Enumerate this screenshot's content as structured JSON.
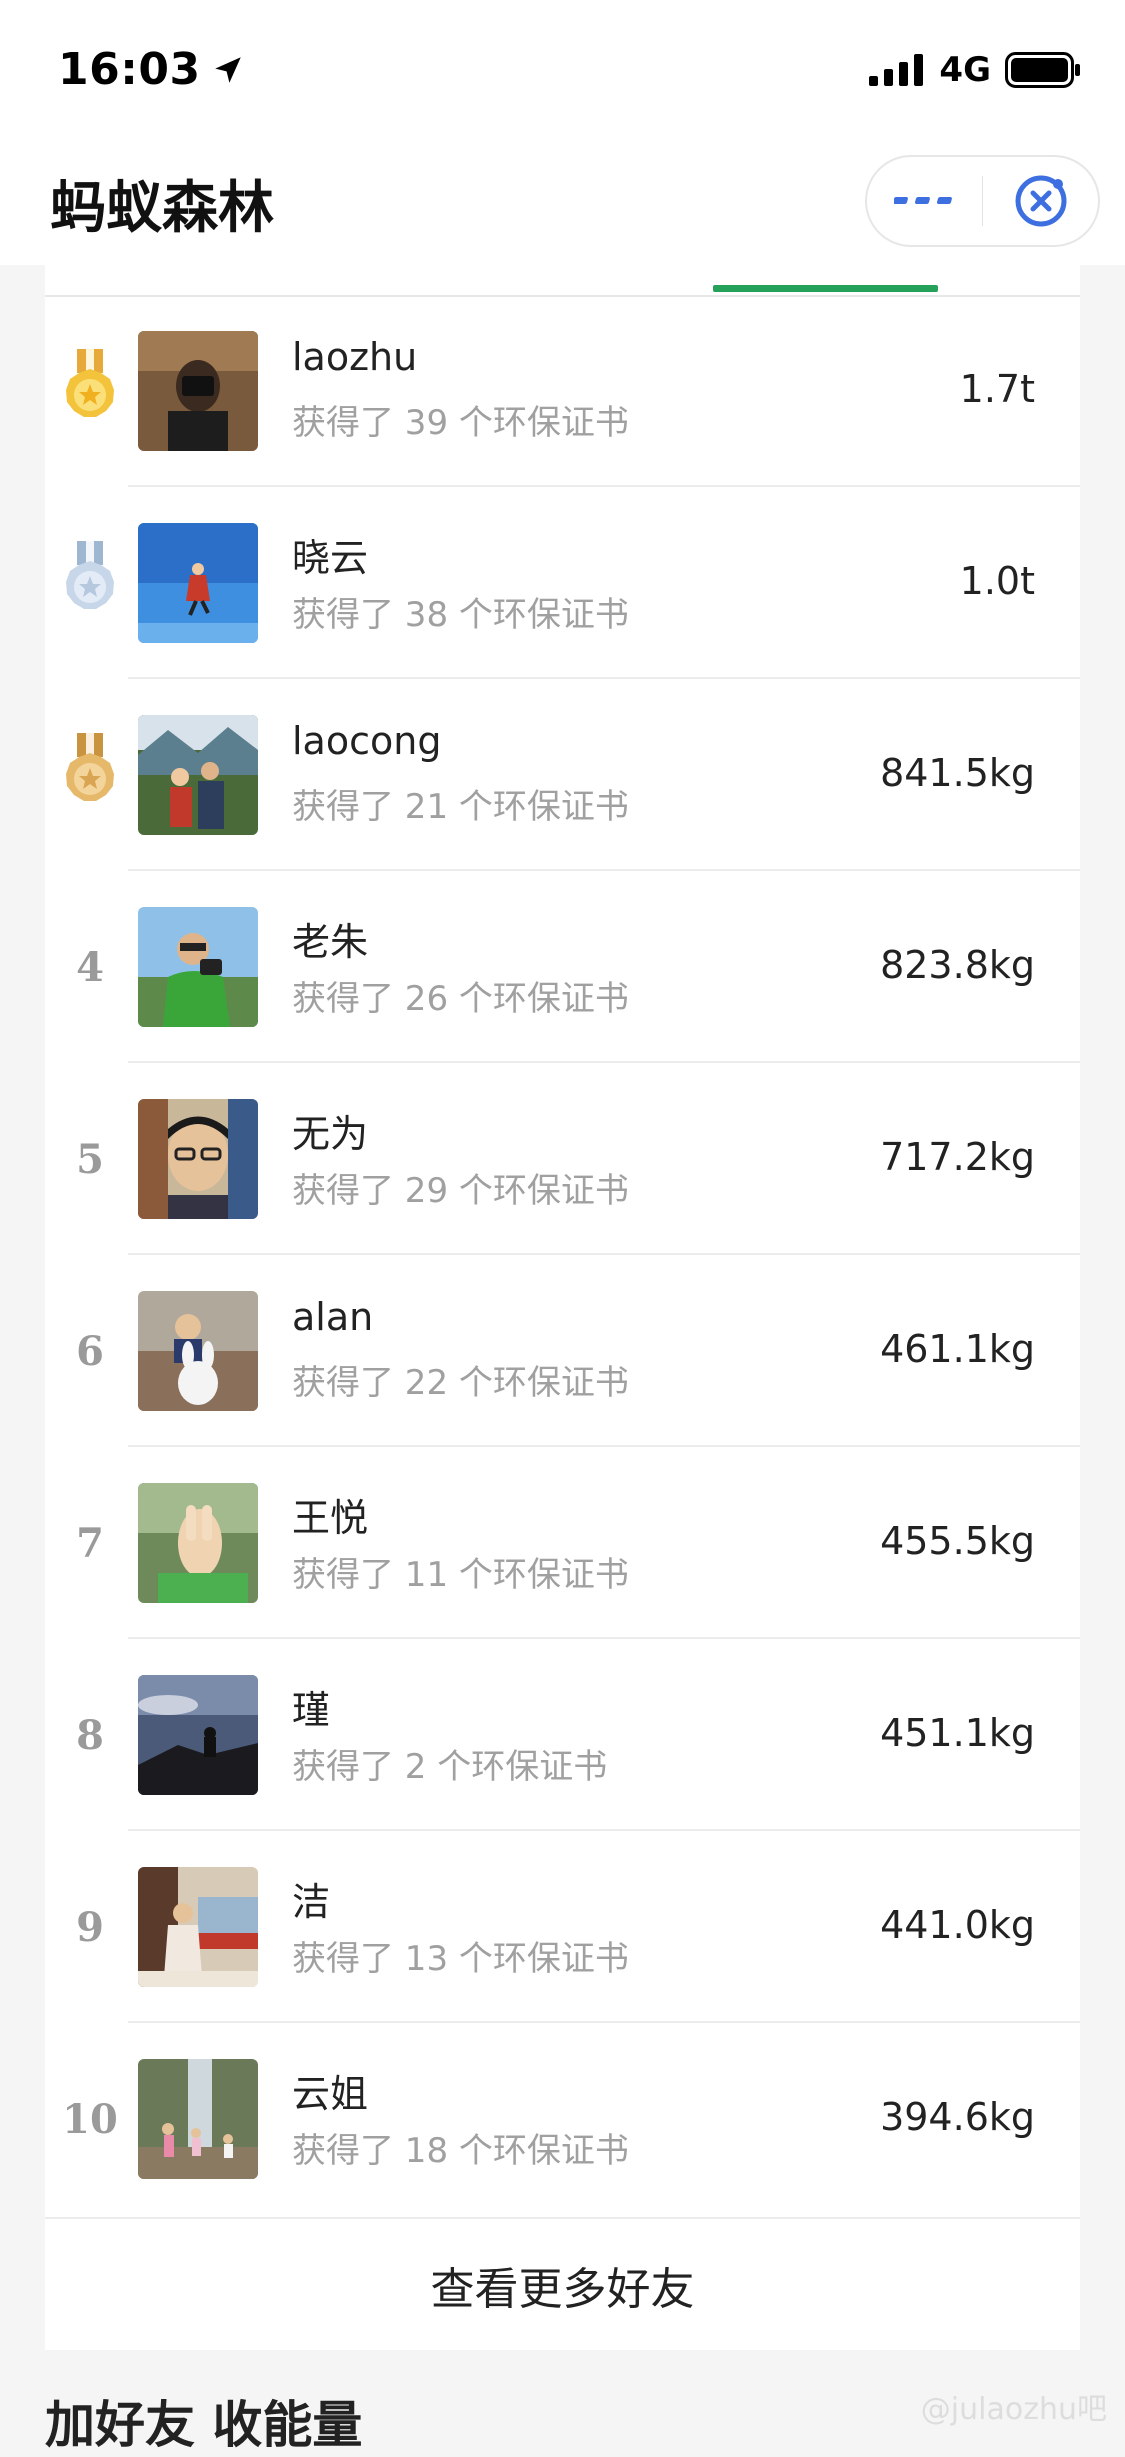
{
  "status_bar": {
    "time": "16:03",
    "network": "4G"
  },
  "header": {
    "title": "蚂蚁森林"
  },
  "tabs": {
    "active_indicator_color": "#26a15a"
  },
  "friends": [
    {
      "rank": "1",
      "medal": "gold",
      "name": "laozhu",
      "certs": "获得了 39 个环保证书",
      "energy": "1.7t"
    },
    {
      "rank": "2",
      "medal": "silver",
      "name": "晓云",
      "certs": "获得了 38 个环保证书",
      "energy": "1.0t"
    },
    {
      "rank": "3",
      "medal": "bronze",
      "name": "laocong",
      "certs": "获得了 21 个环保证书",
      "energy": "841.5kg"
    },
    {
      "rank": "4",
      "name": "老朱",
      "certs": "获得了 26 个环保证书",
      "energy": "823.8kg"
    },
    {
      "rank": "5",
      "name": "无为",
      "certs": "获得了 29 个环保证书",
      "energy": "717.2kg"
    },
    {
      "rank": "6",
      "name": "alan",
      "certs": "获得了 22 个环保证书",
      "energy": "461.1kg"
    },
    {
      "rank": "7",
      "name": "王悦",
      "certs": "获得了 11 个环保证书",
      "energy": "455.5kg"
    },
    {
      "rank": "8",
      "name": "瑾",
      "certs": "获得了 2 个环保证书",
      "energy": "451.1kg"
    },
    {
      "rank": "9",
      "name": "洁",
      "certs": "获得了 13 个环保证书",
      "energy": "441.0kg"
    },
    {
      "rank": "10",
      "name": "云姐",
      "certs": "获得了 18 个环保证书",
      "energy": "394.6kg"
    }
  ],
  "more_button": {
    "label": "查看更多好友"
  },
  "section": {
    "title": "加好友 收能量"
  },
  "watermark": {
    "text": "@julaozhu吧"
  },
  "colors": {
    "accent_blue": "#3d6fe0",
    "accent_green": "#26a15a",
    "gold": "#f0c040",
    "silver": "#c7d6e8",
    "bronze": "#e6b96a"
  }
}
